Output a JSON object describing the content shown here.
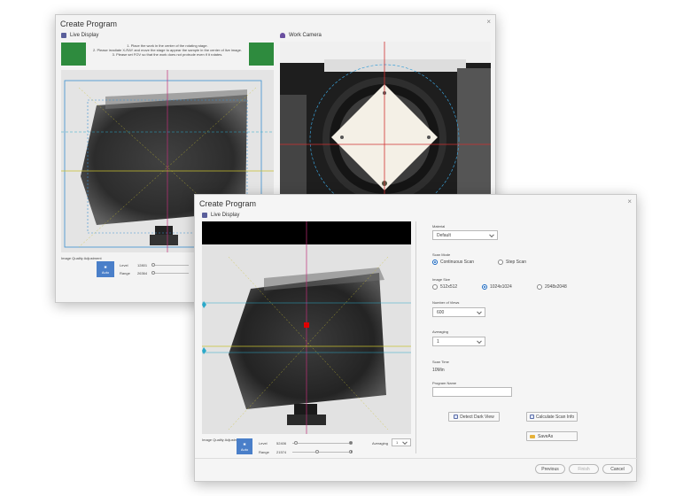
{
  "back_window": {
    "title": "Create Program",
    "close_symbol": "×",
    "live_display": {
      "title": "Live Display",
      "icon": "display-icon"
    },
    "work_camera": {
      "title": "Work Camera",
      "icon": "camera-icon"
    },
    "instructions": [
      "1. Place the work in the center of the rotating stage.",
      "2. Please irradiate X-RAY and move the stage to appear the sample in the center of live image.",
      "3. Please set FOV so that the work does not protrude even if it rotates."
    ],
    "image_quality_label": "Image Quality Adjustment",
    "auto_label": "Auto",
    "level_label": "Level",
    "level_value": "12801",
    "range_label": "Range",
    "range_value": "26364"
  },
  "front_window": {
    "title": "Create Program",
    "close_symbol": "×",
    "live_display": {
      "title": "Live Display",
      "icon": "display-icon"
    },
    "image_quality_label": "Image Quality Adjustment",
    "auto_label": "Auto",
    "level_label": "Level",
    "level_value": "52406",
    "range_label": "Range",
    "range_value": "21574",
    "averaging_label": "Averaging",
    "averaging_value": "1",
    "settings": {
      "material_label": "Material",
      "material_value": "Default",
      "scan_mode_label": "Scan Mode",
      "scan_modes": [
        {
          "label": "Continuous Scan",
          "selected": true
        },
        {
          "label": "Step Scan",
          "selected": false
        }
      ],
      "image_size_label": "Image Size",
      "image_sizes": [
        {
          "label": "512x512",
          "selected": false
        },
        {
          "label": "1024x1024",
          "selected": true
        },
        {
          "label": "2048x2048",
          "selected": false
        }
      ],
      "views_label": "Number of Views",
      "views_value": "600",
      "averaging_label": "Averaging",
      "averaging_value": "1",
      "scan_time_label": "Scan Time",
      "scan_time_value": "10Min",
      "program_name_label": "Program Name",
      "program_name_value": "",
      "detect_dark_view": "Detect Dark View",
      "calculate_scan_info": "Calculate Scan Info",
      "save_as": "SaveAs"
    },
    "footer": {
      "previous": "Previous",
      "finish": "Finish",
      "cancel": "Cancel"
    }
  },
  "colors": {
    "accent_blue": "#1565c0",
    "instruction_green": "#2e8b3e",
    "auto_button": "#4a7fc9",
    "crosshair_magenta": "#c0307a",
    "guide_cyan": "#2aa9c9",
    "guide_yellow": "#c9c030",
    "center_marker": "#e00000"
  }
}
